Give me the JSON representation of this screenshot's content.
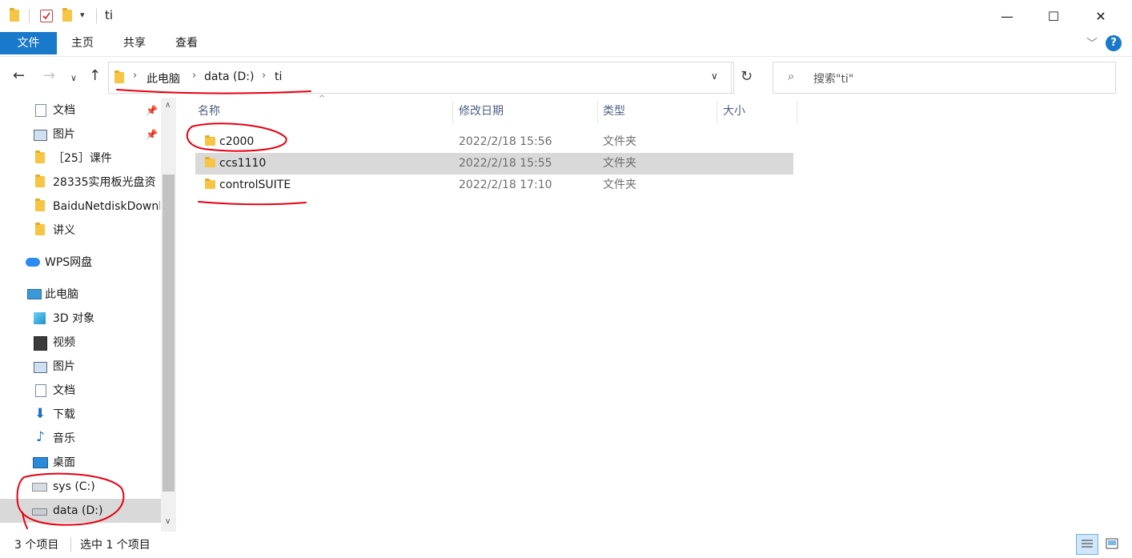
{
  "titlebar": {
    "title": "ti",
    "minimize": "—",
    "maximize": "☐",
    "close": "✕"
  },
  "ribbon": {
    "tabs": [
      "文件",
      "主页",
      "共享",
      "查看"
    ],
    "expand_icon": "chevron-down-icon",
    "help": "?",
    "accent": "#1979ca"
  },
  "nav": {
    "breadcrumb": [
      "此电脑",
      "data (D:)",
      "ti"
    ],
    "search_placeholder": "搜索\"ti\""
  },
  "sidebar": {
    "items": [
      {
        "label": "文档",
        "icon": "document-icon",
        "pinned": true
      },
      {
        "label": "图片",
        "icon": "picture-icon",
        "pinned": true
      },
      {
        "label": "［25］课件",
        "icon": "folder-icon"
      },
      {
        "label": "28335实用板光盘资",
        "icon": "folder-icon"
      },
      {
        "label": "BaiduNetdiskDownl",
        "icon": "folder-icon"
      },
      {
        "label": "讲义",
        "icon": "folder-icon"
      },
      {
        "label": "WPS网盘",
        "icon": "cloud-icon"
      },
      {
        "label": "此电脑",
        "icon": "computer-icon"
      },
      {
        "label": "3D 对象",
        "icon": "cube-icon"
      },
      {
        "label": "视频",
        "icon": "video-icon"
      },
      {
        "label": "图片",
        "icon": "picture-icon"
      },
      {
        "label": "文档",
        "icon": "document-icon"
      },
      {
        "label": "下载",
        "icon": "download-icon"
      },
      {
        "label": "音乐",
        "icon": "music-icon"
      },
      {
        "label": "桌面",
        "icon": "desktop-icon"
      },
      {
        "label": "sys (C:)",
        "icon": "drive-icon"
      },
      {
        "label": "data (D:)",
        "icon": "drive-icon",
        "selected": true
      }
    ]
  },
  "files": {
    "columns": [
      "名称",
      "修改日期",
      "类型",
      "大小"
    ],
    "rows": [
      {
        "name": "c2000",
        "date": "2022/2/18 15:56",
        "type": "文件夹",
        "size": ""
      },
      {
        "name": "ccs1110",
        "date": "2022/2/18 15:55",
        "type": "文件夹",
        "size": "",
        "selected": true
      },
      {
        "name": "controlSUITE",
        "date": "2022/2/18 17:10",
        "type": "文件夹",
        "size": ""
      }
    ]
  },
  "status": {
    "count": "3 个项目",
    "selection": "选中 1 个项目"
  },
  "annotation_color": "#e60012"
}
